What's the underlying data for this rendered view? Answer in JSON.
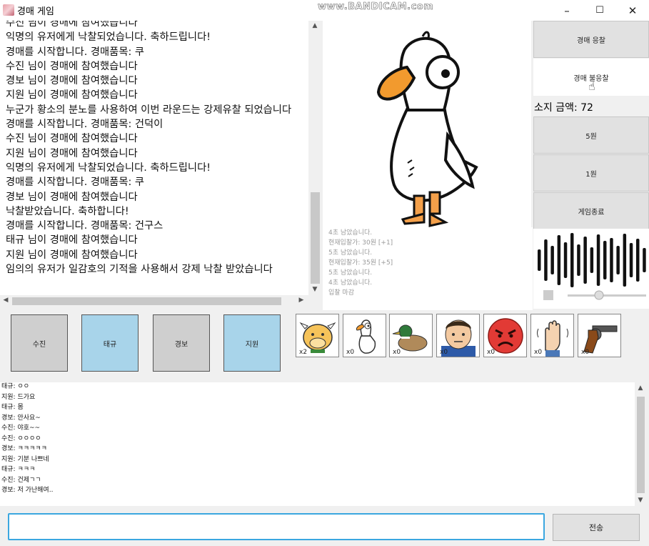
{
  "window": {
    "title": "경매 게임",
    "watermark": "www.BANDICAM.com",
    "minimize": "–",
    "maximize": "☐",
    "close": "✕"
  },
  "log": [
    "수진 님이 경매에 참여했습니다",
    "익명의 유저에게 낙찰되었습니다. 축하드립니다!",
    "경매를 시작합니다. 경매품목: 쿠",
    "수진 님이 경매에 참여했습니다",
    "경보 님이 경매에 참여했습니다",
    "지원 님이 경매에 참여했습니다",
    "누군가 황소의 분노를 사용하여 이번 라운드는 강제유찰 되었습니다",
    "경매를 시작합니다. 경매품목: 건덕이",
    "수진 님이 경매에 참여했습니다",
    "지원 님이 경매에 참여했습니다",
    "익명의 유저에게 낙찰되었습니다. 축하드립니다!",
    "경매를 시작합니다. 경매품목: 쿠",
    "경보 님이 경매에 참여했습니다",
    "낙찰받았습니다. 축하합니다!",
    "경매를 시작합니다. 경매품목: 건구스",
    "태규 님이 경매에 참여했습니다",
    "지원 님이 경매에 참여했습니다",
    "임의의 유저가 일감호의 기적을 사용해서 강제 낙찰 받았습니다"
  ],
  "status_log": [
    "4초 남았습니다.",
    "현재입찰가: 30원 [+1]",
    "5초 남았습니다.",
    "현재입찰가: 35원 [+5]",
    "5초 남았습니다.",
    "4초 남았습니다.",
    "입찰 마감"
  ],
  "buttons": {
    "bid": "경매 응찰",
    "no_bid": "경매 불응찰",
    "five": "5원",
    "one": "1원",
    "end": "게임종료",
    "send": "전송"
  },
  "balance": "소지 금액: 72",
  "players": [
    {
      "name": "수진",
      "color": "#cfcfcf"
    },
    {
      "name": "태규",
      "color": "#a8d4ea"
    },
    {
      "name": "경보",
      "color": "#cfcfcf"
    },
    {
      "name": "지원",
      "color": "#a8d4ea"
    }
  ],
  "items": [
    {
      "icon": "bull-icon",
      "count": "x2"
    },
    {
      "icon": "goose-icon",
      "count": "x0"
    },
    {
      "icon": "duck-icon",
      "count": "x0"
    },
    {
      "icon": "boy-icon",
      "count": "x0"
    },
    {
      "icon": "angry-face-icon",
      "count": "x0"
    },
    {
      "icon": "raised-hand-icon",
      "count": "x0"
    },
    {
      "icon": "revolver-icon",
      "count": "x0"
    }
  ],
  "chat": [
    "태규: ㅇㅇ",
    "지원: 드가요",
    "태규: 몸",
    "경보: 안사요~",
    "수진: 야호~~",
    "수진: ㅇㅇㅇㅇ",
    "경보: ㅋㅋㅋㅋㅋ",
    "지원: 기분 나쁘네",
    "태규: ㅋㅋㅋ",
    "수진: 건제ㄱㄱ",
    "경보: 저 가난해여.."
  ],
  "chat_input": {
    "value": "",
    "placeholder": ""
  }
}
